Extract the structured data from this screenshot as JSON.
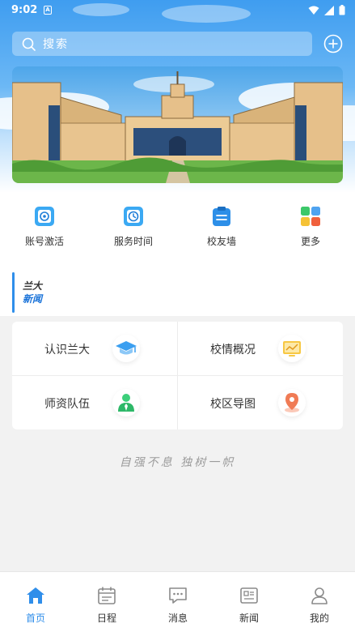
{
  "status_bar": {
    "time": "9:02",
    "notification_icon": "A"
  },
  "search": {
    "placeholder": "搜索"
  },
  "banner": {
    "image": "campus-building-illustration"
  },
  "quick_actions": [
    {
      "label": "账号激活",
      "icon": "account-activate-icon"
    },
    {
      "label": "服务时间",
      "icon": "service-time-icon"
    },
    {
      "label": "校友墙",
      "icon": "alumni-wall-icon"
    },
    {
      "label": "更多",
      "icon": "more-apps-icon"
    }
  ],
  "news_header": {
    "line1": "兰大",
    "line2": "新闻"
  },
  "grid": [
    {
      "label": "认识兰大",
      "icon": "graduation-cap-icon"
    },
    {
      "label": "校情概况",
      "icon": "overview-chart-icon"
    },
    {
      "label": "师资队伍",
      "icon": "faculty-icon"
    },
    {
      "label": "校区导图",
      "icon": "map-pin-icon"
    }
  ],
  "slogan": "自强不息  独树一帜",
  "tabs": [
    {
      "label": "首页",
      "icon": "home-icon",
      "active": true
    },
    {
      "label": "日程",
      "icon": "calendar-icon",
      "active": false
    },
    {
      "label": "消息",
      "icon": "message-icon",
      "active": false
    },
    {
      "label": "新闻",
      "icon": "news-icon",
      "active": false
    },
    {
      "label": "我的",
      "icon": "profile-icon",
      "active": false
    }
  ],
  "colors": {
    "primary": "#2f8eea",
    "header_top": "#3f9df0"
  }
}
